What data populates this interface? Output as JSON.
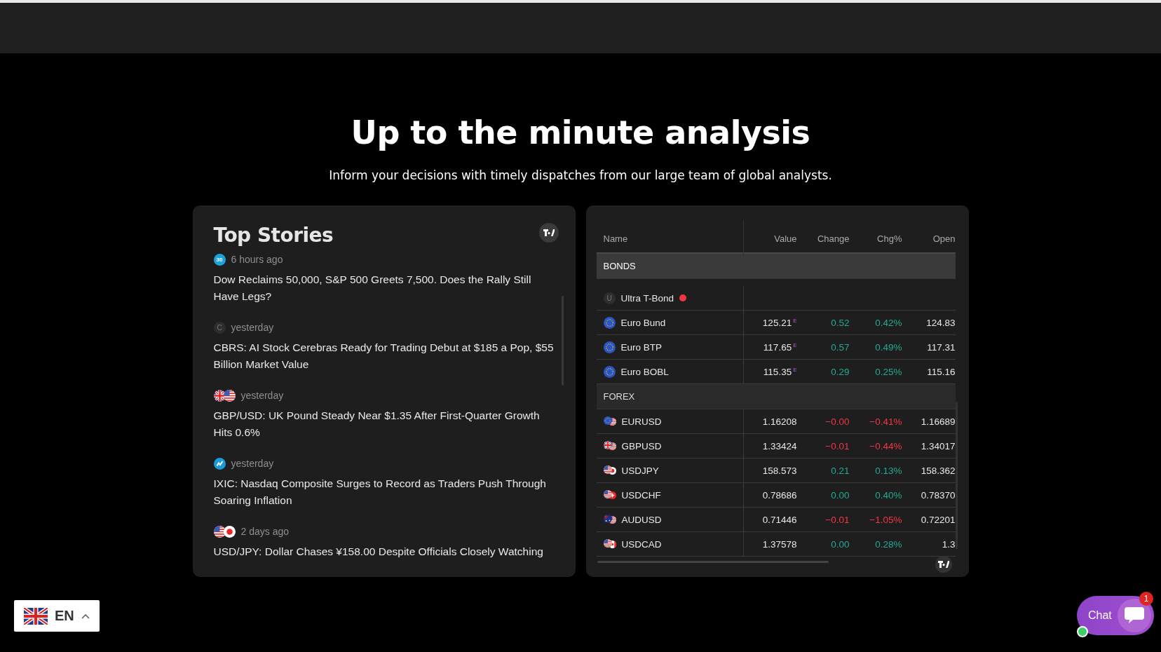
{
  "heading": "Up to the minute analysis",
  "subheading": "Inform your decisions with timely dispatches from our large team of global analysts.",
  "stories": {
    "title": "Top Stories",
    "items": [
      {
        "icon": {
          "kind": "badge",
          "text": "30"
        },
        "time": "6 hours ago",
        "headline": "Dow Reclaims 50,000, S&P 500 Greets 7,500. Does the Rally Still Have Legs?"
      },
      {
        "icon": {
          "kind": "letter",
          "text": "C"
        },
        "time": "yesterday",
        "headline": "CBRS: AI Stock Cerebras Ready for Trading Debut at $185 a Pop, $55 Billion Market Value"
      },
      {
        "icon": {
          "kind": "flags"
        },
        "time": "yesterday",
        "headline": "GBP/USD: UK Pound Steady Near $1.35 After First-Quarter Growth Hits 0.6%"
      },
      {
        "icon": {
          "kind": "chart"
        },
        "time": "yesterday",
        "headline": "IXIC: Nasdaq Composite Surges to Record as Traders Push Through Soaring Inflation"
      },
      {
        "icon": {
          "kind": "flags"
        },
        "time": "2 days ago",
        "headline": "USD/JPY: Dollar Chases ¥158.00 Despite Officials Closely Watching"
      }
    ]
  },
  "quotes": {
    "columns": [
      "Name",
      "Value",
      "Change",
      "Chg%",
      "Open"
    ],
    "rows": [
      {
        "kind": "group",
        "name": "BONDS",
        "pinned": true
      },
      {
        "kind": "row",
        "icon": {
          "kind": "letter",
          "text": "U"
        },
        "name": "Ultra T-Bond",
        "alert": true
      },
      {
        "kind": "row",
        "icon": {
          "kind": "flag"
        },
        "name": "Euro Bund",
        "value": "125.21$^{E}$",
        "change": "0.52",
        "pct": "0.42%",
        "open": "124.83",
        "rising": true
      },
      {
        "kind": "row",
        "icon": {
          "kind": "flag"
        },
        "name": "Euro BTP",
        "value": "117.65$^{E}$",
        "change": "0.57",
        "pct": "0.49%",
        "open": "117.31",
        "rising": true
      },
      {
        "kind": "row",
        "icon": {
          "kind": "flag"
        },
        "name": "Euro BOBL",
        "value": "115.35$^{E}$",
        "change": "0.29",
        "pct": "0.25%",
        "open": "115.16",
        "rising": true
      },
      {
        "kind": "group",
        "name": "FOREX",
        "pinned": false
      },
      {
        "kind": "row",
        "icon": {
          "kind": "pair"
        },
        "name": "EURUSD",
        "value": "1.16208",
        "change": "−0.00",
        "pct": "−0.41%",
        "open": "1.16689",
        "rising": false
      },
      {
        "kind": "row",
        "icon": {
          "kind": "pair"
        },
        "name": "GBPUSD",
        "value": "1.33424",
        "change": "−0.01",
        "pct": "−0.44%",
        "open": "1.34017",
        "rising": false
      },
      {
        "kind": "row",
        "icon": {
          "kind": "pair"
        },
        "name": "USDJPY",
        "value": "158.573",
        "change": "0.21",
        "pct": "0.13%",
        "open": "158.362",
        "rising": true
      },
      {
        "kind": "row",
        "icon": {
          "kind": "pair"
        },
        "name": "USDCHF",
        "value": "0.78686",
        "change": "0.00",
        "pct": "0.40%",
        "open": "0.78370",
        "rising": true
      },
      {
        "kind": "row",
        "icon": {
          "kind": "pair"
        },
        "name": "AUDUSD",
        "value": "0.71446",
        "change": "−0.01",
        "pct": "−1.05%",
        "open": "0.72201",
        "rising": false
      },
      {
        "kind": "row",
        "icon": {
          "kind": "pair"
        },
        "name": "USDCAD",
        "value": "1.37578",
        "change": "0.00",
        "pct": "0.28%",
        "open": "1.3",
        "rising": true
      }
    ]
  },
  "language": {
    "code": "EN"
  },
  "chat": {
    "label": "Chat",
    "count": "1",
    "online": true
  }
}
